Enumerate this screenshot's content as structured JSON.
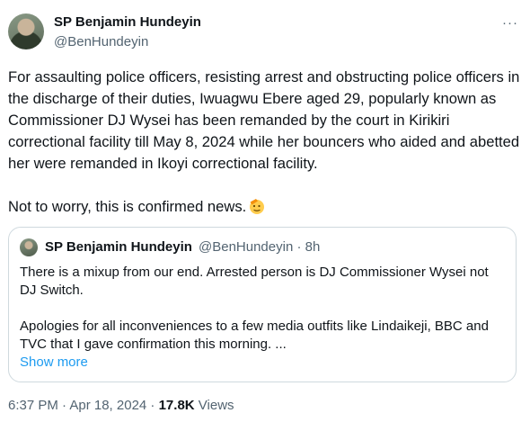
{
  "author": {
    "name": "SP Benjamin Hundeyin",
    "handle": "@BenHundeyin",
    "more_icon": "···"
  },
  "tweet": {
    "paragraph1": "For assaulting police officers, resisting arrest and obstructing police officers in the discharge of their duties, Iwuagwu Ebere aged 29, popularly known as Commissioner DJ Wysei has been remanded by the court in Kirikiri correctional facility till May 8, 2024 while her bouncers who aided and abetted her were remanded in Ikoyi correctional facility.",
    "paragraph2": "Not to worry, this is confirmed news.",
    "emoji": "saluting-face-icon"
  },
  "quote": {
    "name": "SP Benjamin Hundeyin",
    "meta": "@BenHundeyin · 8h",
    "line1": "There is a mixup from our end. Arrested person is DJ Commissioner Wysei not DJ Switch.",
    "line2": "Apologies for all inconveniences to a few media outfits like Lindaikeji, BBC and TVC that I gave confirmation this morning. ...",
    "show_more": "Show more"
  },
  "footer": {
    "timestamp": "6:37 PM · Apr 18, 2024 · ",
    "views_count": "17.8K",
    "views_label": " Views"
  },
  "colors": {
    "text": "#0f1419",
    "secondary": "#536471",
    "link": "#1d9bf0",
    "border": "#cfd9de"
  }
}
